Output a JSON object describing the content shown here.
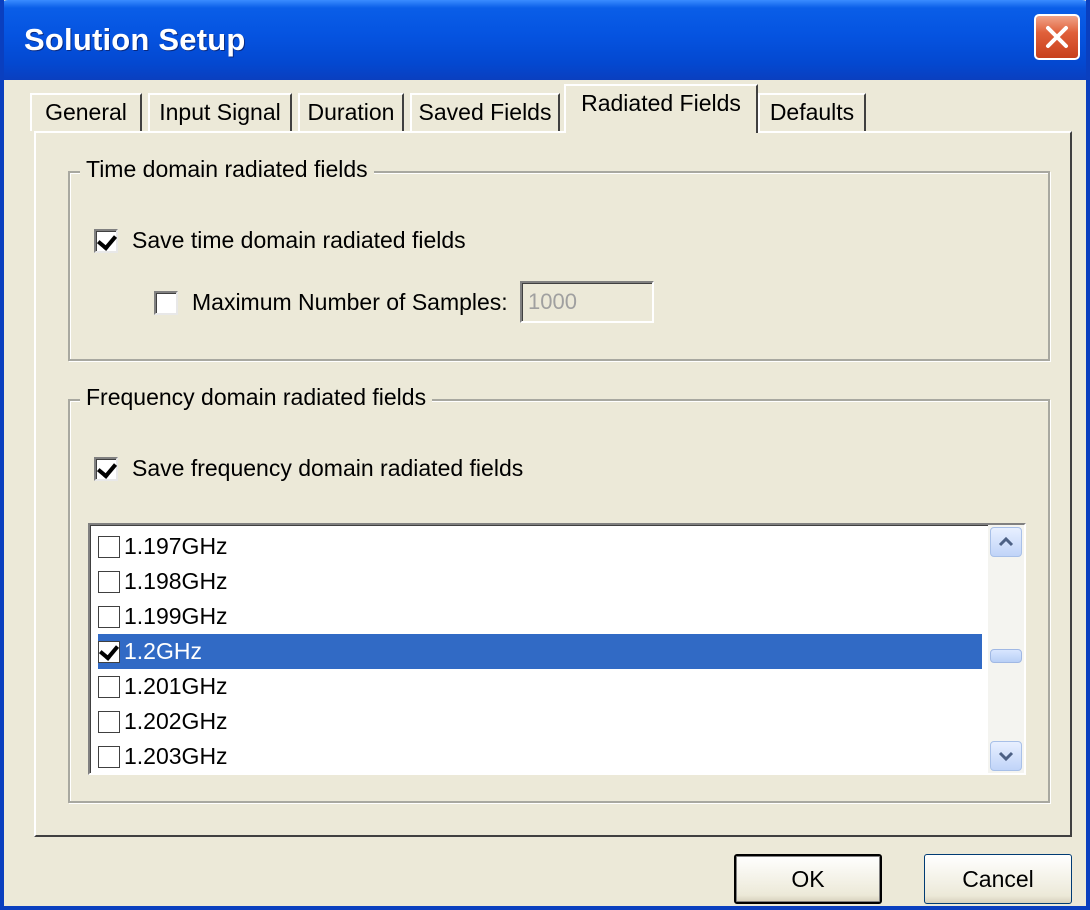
{
  "window": {
    "title": "Solution Setup"
  },
  "tabs": [
    {
      "label": "General"
    },
    {
      "label": "Input Signal"
    },
    {
      "label": "Duration"
    },
    {
      "label": "Saved Fields"
    },
    {
      "label": "Radiated Fields",
      "active": true
    },
    {
      "label": "Defaults"
    }
  ],
  "time_domain": {
    "legend": "Time domain radiated fields",
    "save_label": "Save time domain radiated fields",
    "save_checked": true,
    "max_samples_label": "Maximum Number of Samples:",
    "max_samples_checked": false,
    "max_samples_value": "1000"
  },
  "frequency_domain": {
    "legend": "Frequency domain radiated fields",
    "save_label": "Save frequency domain radiated fields",
    "save_checked": true,
    "frequencies": [
      {
        "label": "1.197GHz",
        "checked": false
      },
      {
        "label": "1.198GHz",
        "checked": false
      },
      {
        "label": "1.199GHz",
        "checked": false
      },
      {
        "label": "1.2GHz",
        "checked": true,
        "selected": true
      },
      {
        "label": "1.201GHz",
        "checked": false
      },
      {
        "label": "1.202GHz",
        "checked": false
      },
      {
        "label": "1.203GHz",
        "checked": false
      }
    ]
  },
  "buttons": {
    "ok": "OK",
    "cancel": "Cancel"
  },
  "colors": {
    "selection": "#316ac5",
    "titlebar": "#0553e0",
    "dialog_face": "#ece9d8"
  }
}
